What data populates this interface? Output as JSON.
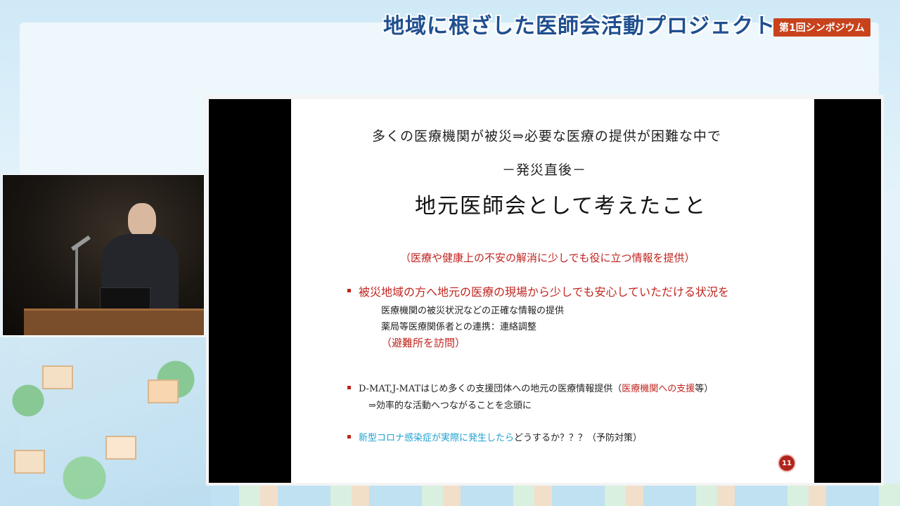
{
  "banner": {
    "title": "地域に根ざした医師会活動プロジェクト",
    "badge": "第1回シンポジウム"
  },
  "slide": {
    "line1": "多くの医療機関が被災⇒必要な医療の提供が困難な中で",
    "line2": "－発災直後－",
    "heading": "地元医師会として考えたこと",
    "subheading": "（医療や健康上の不安の解消に少しでも役に立つ情報を提供）",
    "bullet1": {
      "text": "被災地域の方へ地元の医療の現場から少しでも安心していただける状況を",
      "sub1": "医療機関の被災状況などの正確な情報の提供",
      "sub2": "薬局等医療関係者との連携：連絡調整",
      "sub3": "（避難所を訪問）"
    },
    "bullet2": {
      "text_a": "D-MAT,J-MATはじめ多くの支援団体への地元の医療情報提供（",
      "text_red": "医療機関への支援",
      "text_b": "等）",
      "sub1": "⇒効率的な活動へつながることを念頭に"
    },
    "bullet3": {
      "text_blue": "新型コロナ感染症が実際に発生したら",
      "text_b": "どうするか？？？（予防対策）"
    },
    "page_number": "11"
  },
  "colors": {
    "accent_red": "#c0251f",
    "accent_blue": "#1fa0d0",
    "banner_blue": "#1f4f8f",
    "badge_red": "#c8421c"
  }
}
